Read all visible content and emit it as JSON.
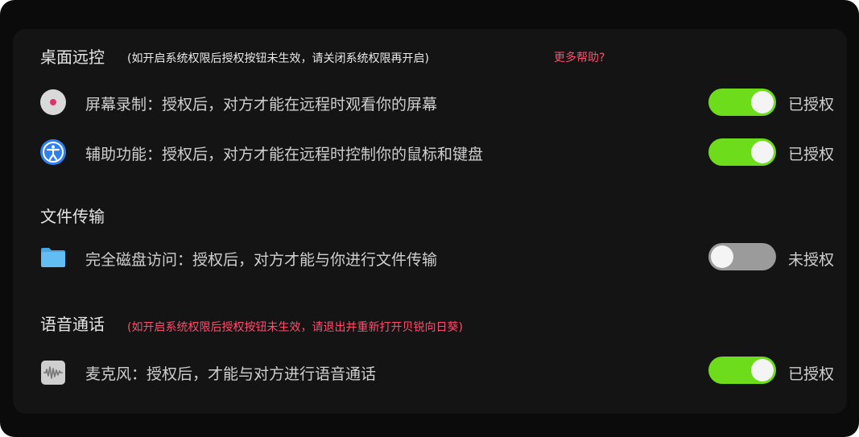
{
  "sections": {
    "remote": {
      "title": "桌面远控",
      "note": "(如开启系统权限后授权按钮未生效，请关闭系统权限再开启)",
      "help_link": "更多帮助?"
    },
    "file": {
      "title": "文件传输"
    },
    "voice": {
      "title": "语音通话",
      "note": "(如开启系统权限后授权按钮未生效，请退出并重新打开贝锐向日葵)"
    }
  },
  "rows": [
    {
      "icon": "record-icon",
      "text": "屏幕录制：授权后，对方才能在远程时观看你的屏幕",
      "status": "已授权",
      "enabled": true
    },
    {
      "icon": "accessibility-icon",
      "text": "辅助功能：授权后，对方才能在远程时控制你的鼠标和键盘",
      "status": "已授权",
      "enabled": true
    },
    {
      "icon": "folder-icon",
      "text": "完全磁盘访问：授权后，对方才能与你进行文件传输",
      "status": "未授权",
      "enabled": false
    },
    {
      "icon": "microphone-icon",
      "text": "麦克风：授权后，才能与对方进行语音通话",
      "status": "已授权",
      "enabled": true
    }
  ],
  "colors": {
    "toggle_on": "#6ddc1b",
    "toggle_off": "#9b9b9b",
    "warning_text": "#ff4b6e",
    "background": "#141414"
  }
}
